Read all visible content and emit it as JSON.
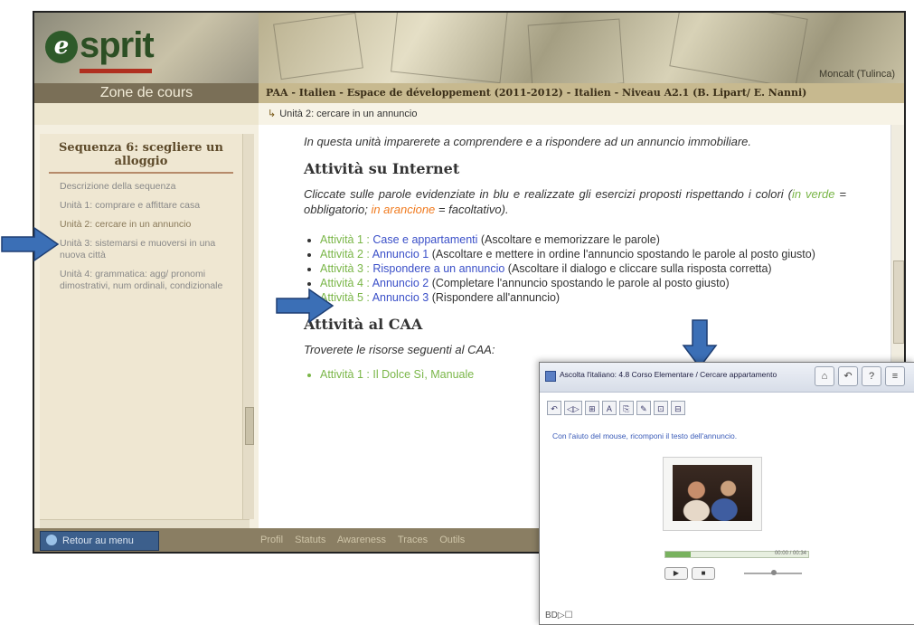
{
  "logo": {
    "text": "sprit",
    "letter": "e"
  },
  "banner": {
    "user": "Moncalt (Tulinca)"
  },
  "zone": {
    "label": "Zone de cours"
  },
  "course": {
    "title": "PAA - Italien - Espace de développement (2011-2012) - Italien - Niveau A2.1 (B. Lipart/ E. Nanni)"
  },
  "breadcrumb": {
    "text": "Unità 2: cercare in un annuncio"
  },
  "sidebar": {
    "title": "Sequenza 6: scegliere un alloggio",
    "items": [
      {
        "label": "Descrizione della sequenza"
      },
      {
        "label": "Unità 1: comprare e affittare casa"
      },
      {
        "label": "Unità 2: cercare in un annuncio"
      },
      {
        "label": "Unità 3: sistemarsi e muoversi in una nuova città"
      },
      {
        "label": "Unità 4: grammatica: agg/ pronomi dimostrativi, num ordinali, condizionale"
      }
    ]
  },
  "content": {
    "intro": "In questa unità imparerete a comprendere e a rispondere ad un annuncio immobiliare.",
    "section1": "Attività su Internet",
    "instr_pre": "Cliccate sulle parole evidenziate in blu e realizzate gli esercizi proposti rispettando i colori (",
    "instr_green": "in verde",
    "instr_mid": " = obbligatorio; ",
    "instr_orange": "in arancione",
    "instr_post": " = facoltativo).",
    "activities": [
      {
        "tag": "Attività 1 :",
        "link": "Case e appartamenti",
        "desc": " (Ascoltare e memorizzare le parole)"
      },
      {
        "tag": "Attività 2 :",
        "link": "Annuncio 1",
        "desc": " (Ascoltare e mettere in ordine l'annuncio spostando le parole al posto giusto)"
      },
      {
        "tag": "Attività 3 :",
        "link": "Rispondere a un annuncio",
        "desc": " (Ascoltare il dialogo e cliccare sulla risposta corretta)"
      },
      {
        "tag": "Attività 4 :",
        "link": "Annuncio 2",
        "desc": " (Completare l'annuncio spostando le parole al posto giusto)"
      },
      {
        "tag": "Attività 5 :",
        "link": "Annuncio 3",
        "desc": " (Rispondere all'annuncio)"
      }
    ],
    "section2": "Attività al CAA",
    "caa_intro": "Troverete le risorse seguenti al CAA:",
    "caa_item": "Attività 1 : Il Dolce Sì, Manuale"
  },
  "bottom": {
    "back_label": "Retour au menu",
    "links": [
      "Profil",
      "Statuts",
      "Awareness",
      "Traces",
      "Outils"
    ]
  },
  "popup": {
    "title": "Ascolta l'italiano: 4.8 Corso Elementare / Cercare appartamento",
    "instruction": "Con l'aiuto del mouse, ricomponi il testo dell'annuncio.",
    "footer": "BD▷☐",
    "time": "00:00 / 00:34",
    "progress_fraction": 0.18,
    "tools": [
      "⌂",
      "↶",
      "?",
      "≡"
    ],
    "toolbar": [
      "↶",
      "◁▷",
      "⊞",
      "A",
      "⎘",
      "✎",
      "⊡",
      "⊟"
    ],
    "play": [
      "▶",
      "■"
    ]
  },
  "colors": {
    "accent_blue": "#3a4fc8",
    "mandatory_green": "#7ab648",
    "optional_orange": "#f07a1e",
    "arrow_blue": "#3b6fb6"
  }
}
